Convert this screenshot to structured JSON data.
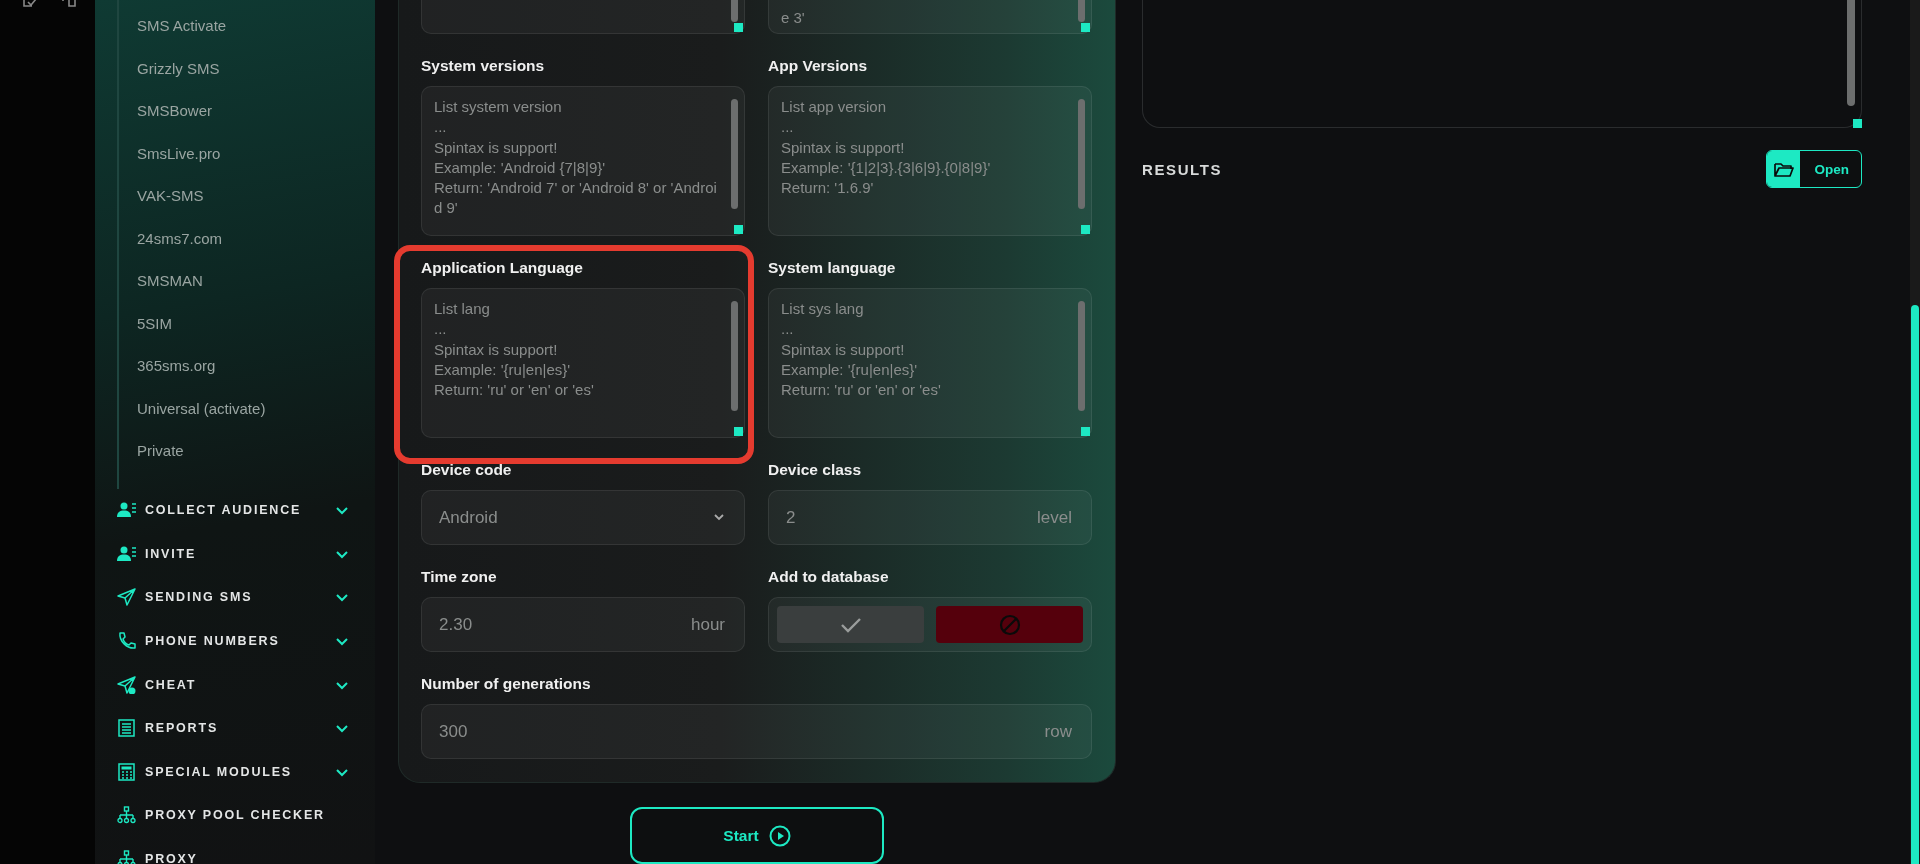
{
  "sidebar": {
    "submenu_items": [
      "SMS Activate",
      "Grizzly SMS",
      "SMSBower",
      "SmsLive.pro",
      "VAK-SMS",
      "24sms7.com",
      "SMSMAN",
      "5SIM",
      "365sms.org",
      "Universal (activate)",
      "Private"
    ],
    "sections": [
      {
        "label": "COLLECT AUDIENCE",
        "expandable": true
      },
      {
        "label": "INVITE",
        "expandable": true
      },
      {
        "label": "SENDING SMS",
        "expandable": true
      },
      {
        "label": "PHONE NUMBERS",
        "expandable": true
      },
      {
        "label": "CHEAT",
        "expandable": true
      },
      {
        "label": "REPORTS",
        "expandable": true
      },
      {
        "label": "SPECIAL MODULES",
        "expandable": true
      },
      {
        "label": "PROXY POOL CHECKER",
        "expandable": false
      },
      {
        "label": "PROXY",
        "expandable": false
      }
    ]
  },
  "form": {
    "fields": [
      {
        "kind": "textarea",
        "highlighted": false
      },
      {
        "kind": "textarea",
        "placeholder": "e 3'",
        "highlighted": false
      },
      {
        "kind": "textarea",
        "label": "System versions",
        "placeholder": "List system version\n...\nSpintax is support!\nExample: 'Android {7|8|9}'\nReturn: 'Android 7' or 'Android 8' or 'Android 9'",
        "highlighted": false
      },
      {
        "kind": "textarea",
        "label": "App Versions",
        "placeholder": "List app version\n...\nSpintax is support!\nExample: '{1|2|3}.{3|6|9}.{0|8|9}'\nReturn: '1.6.9'",
        "highlighted": false
      },
      {
        "kind": "textarea",
        "label": "Application Language",
        "placeholder": "List lang\n...\nSpintax is support!\nExample: '{ru|en|es}'\nReturn: 'ru' or 'en' or 'es'",
        "highlighted": true
      },
      {
        "kind": "textarea",
        "label": "System language",
        "placeholder": "List sys lang\n...\nSpintax is support!\nExample: '{ru|en|es}'\nReturn: 'ru' or 'en' or 'es'",
        "highlighted": false
      },
      {
        "kind": "select",
        "label": "Device code",
        "value": "Android",
        "highlighted": false
      },
      {
        "kind": "unit",
        "label": "Device class",
        "placeholder": "2",
        "unit": "level",
        "highlighted": false
      },
      {
        "kind": "unit",
        "label": "Time zone",
        "placeholder": "2.30",
        "unit": "hour",
        "highlighted": false
      },
      {
        "kind": "toggle",
        "label": "Add to database",
        "checked": false,
        "highlighted": false
      }
    ],
    "full_width_field": {
      "kind": "unit",
      "label": "Number of generations",
      "placeholder": "300",
      "unit": "row"
    }
  },
  "start_button": {
    "label": "Start"
  },
  "results": {
    "title": "RESULTS",
    "open_button": {
      "label": "Open"
    }
  }
}
